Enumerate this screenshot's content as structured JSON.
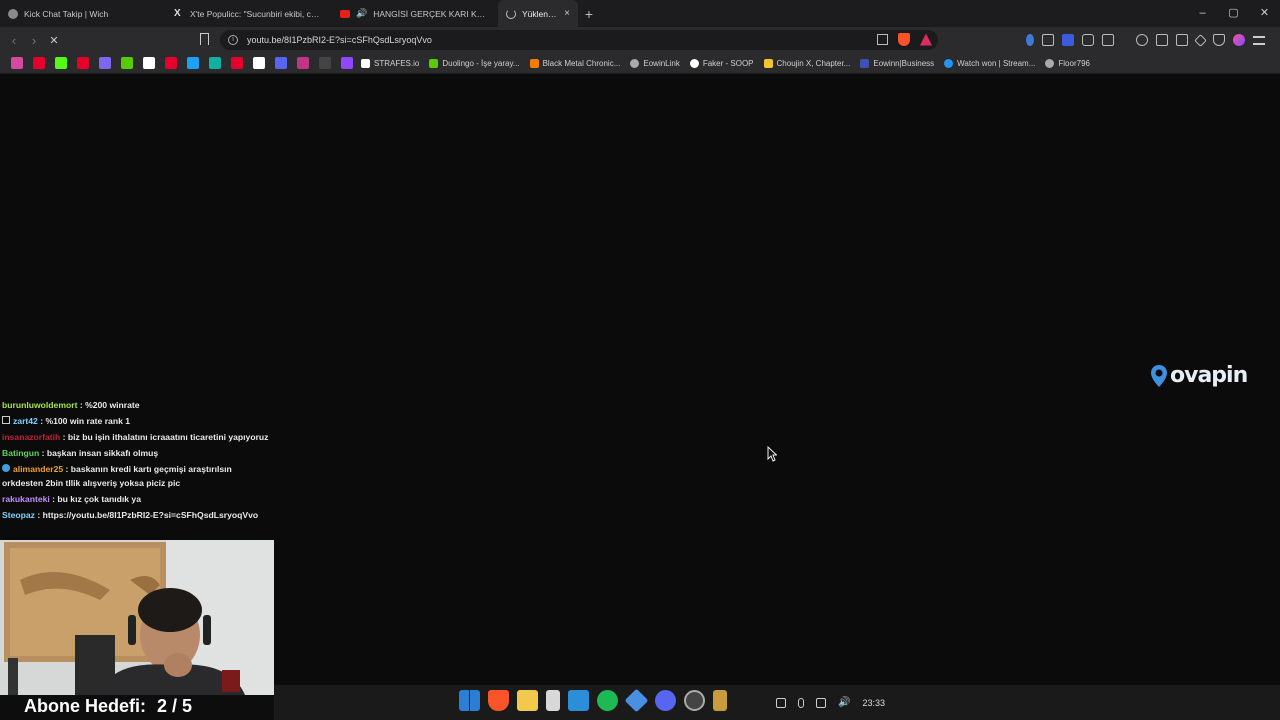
{
  "tabs": [
    {
      "title": "Kick Chat Takip | Wich",
      "color": "#8a8a8a"
    },
    {
      "title": "X'te Populicc: \"Sucunbiri ekibi, cüceler",
      "color": "#dddddd"
    },
    {
      "title": "HANGİSİ GERÇEK KARI KOCA?! ft.",
      "color": "#e62117"
    },
    {
      "title": "Yükleniyor",
      "color": "#cccccc",
      "active": true
    }
  ],
  "tabstrip": {
    "new_tab": "+",
    "close": "×"
  },
  "window": {
    "minimize": "–",
    "maximize": "▢",
    "close": "✕"
  },
  "toolbar": {
    "back": "‹",
    "forward": "›",
    "reload": "✕",
    "url": "youtu.be/8I1PzbRI2-E?si=cSFhQsdLsryoqVvo"
  },
  "bookmarks": {
    "icons": [
      "#d44aa0",
      "#e4002b",
      "#53fc18",
      "#e4002b",
      "#7b68ee",
      "#58cc02",
      "#ffffff",
      "#e4002b",
      "#1da1f2",
      "#e4002b",
      "#ffffff",
      "#5865f2",
      "#c13584",
      "#222222",
      "#9146ff"
    ],
    "items": [
      {
        "label": "STRAFES.io",
        "color": "#ffffff"
      },
      {
        "label": "Duolingo - İşe yaray...",
        "color": "#58cc02"
      },
      {
        "label": "Black Metal Chronic...",
        "color": "#f57c00"
      },
      {
        "label": "EowinLink",
        "color": "#aaaaaa"
      },
      {
        "label": "Faker - SOOP",
        "color": "#ffffff"
      },
      {
        "label": "Choujin X, Chapter...",
        "color": "#f4c430"
      },
      {
        "label": "Eowinn|Business",
        "color": "#3f51b5"
      },
      {
        "label": "Watch won | Stream...",
        "color": "#2196f3"
      },
      {
        "label": "Floor796",
        "color": "#aaaaaa"
      }
    ]
  },
  "logo": {
    "text": "ovapin",
    "color": "#3d8fe0"
  },
  "chat": [
    {
      "user": "burunluwoldemort",
      "color": "#a6e34b",
      "text": " : %200 winrate"
    },
    {
      "user": "zart42",
      "color": "#7fd3ff",
      "text": " : %100 win rate rank 1"
    },
    {
      "user": "insanazorfatih",
      "color": "#c0203a",
      "text": " : biz bu işin ithalatını icraaatını ticaretini yapıyoruz"
    },
    {
      "user": "Batingun",
      "color": "#5fd35f",
      "text": " : başkan insan sikkafı olmuş"
    },
    {
      "user": "alimander25",
      "color": "#f0a030",
      "text": " : baskanın kredi kartı geçmişi araştırılsın orkdesten 2bin tllik alışveriş yoksa piciz pic"
    },
    {
      "user": "rakukanteki",
      "color": "#c48dff",
      "text": " : bu kız çok tanıdık ya"
    },
    {
      "user": "Steopaz",
      "color": "#7fd3ff",
      "text": " : https://youtu.be/8I1PzbRI2-E?si=cSFhQsdLsryoqVvo"
    }
  ],
  "goal": {
    "label": "Abone Hedefi:",
    "value": "2 / 5"
  },
  "taskbar": {
    "apps": [
      "#2a7fd4",
      "#fb542b",
      "#f2c94c",
      "#d8d8d8",
      "#2a8fd8",
      "#1db954",
      "#4a90e2",
      "#5865f2",
      "#888888",
      "#c89b3c"
    ],
    "time": "23:33"
  }
}
